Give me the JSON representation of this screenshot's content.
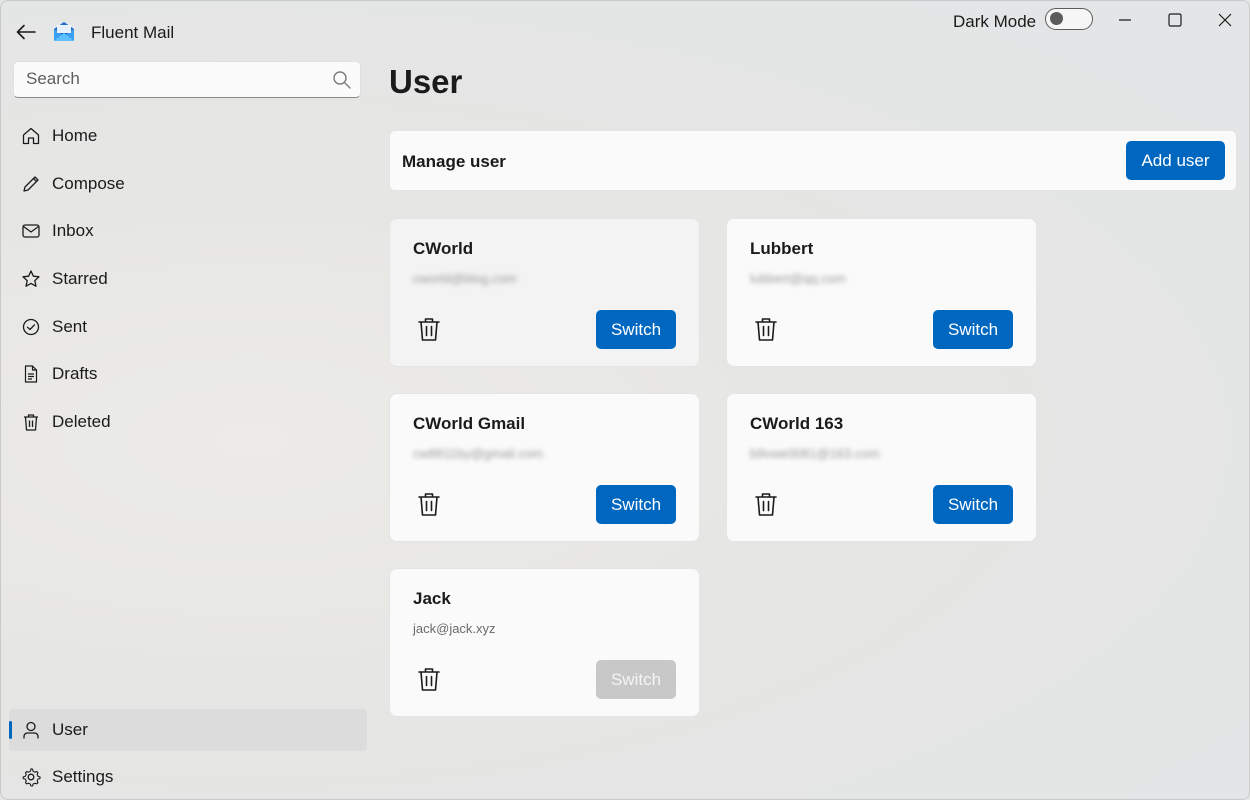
{
  "app": {
    "title": "Fluent Mail",
    "dark_mode_label": "Dark Mode",
    "dark_mode_on": false
  },
  "search": {
    "placeholder": "Search",
    "value": ""
  },
  "nav": {
    "items": [
      {
        "label": "Home",
        "icon": "home-icon"
      },
      {
        "label": "Compose",
        "icon": "pencil-icon"
      },
      {
        "label": "Inbox",
        "icon": "mail-icon"
      },
      {
        "label": "Starred",
        "icon": "star-icon"
      },
      {
        "label": "Sent",
        "icon": "check-circle-icon"
      },
      {
        "label": "Drafts",
        "icon": "document-icon"
      },
      {
        "label": "Deleted",
        "icon": "trash-icon"
      }
    ],
    "bottom": [
      {
        "label": "User",
        "icon": "person-icon",
        "selected": true
      },
      {
        "label": "Settings",
        "icon": "gear-icon"
      }
    ]
  },
  "page": {
    "title": "User",
    "manage_label": "Manage user",
    "add_user_label": "Add user"
  },
  "users": [
    {
      "name": "CWorld",
      "email": "cworld@blog.com",
      "email_blurred": true,
      "switch_label": "Switch",
      "switch_enabled": true
    },
    {
      "name": "Lubbert",
      "email": "lubbert@qq.com",
      "email_blurred": true,
      "switch_label": "Switch",
      "switch_enabled": true
    },
    {
      "name": "CWorld Gmail",
      "email": "cw8811by@gmail.com",
      "email_blurred": true,
      "switch_label": "Switch",
      "switch_enabled": true
    },
    {
      "name": "CWorld 163",
      "email": "b9vwe0081@163.com",
      "email_blurred": true,
      "switch_label": "Switch",
      "switch_enabled": true
    },
    {
      "name": "Jack",
      "email": "jack@jack.xyz",
      "email_blurred": false,
      "switch_label": "Switch",
      "switch_enabled": false
    }
  ],
  "colors": {
    "accent": "#0067c0",
    "disabled": "#c8c8c8"
  }
}
